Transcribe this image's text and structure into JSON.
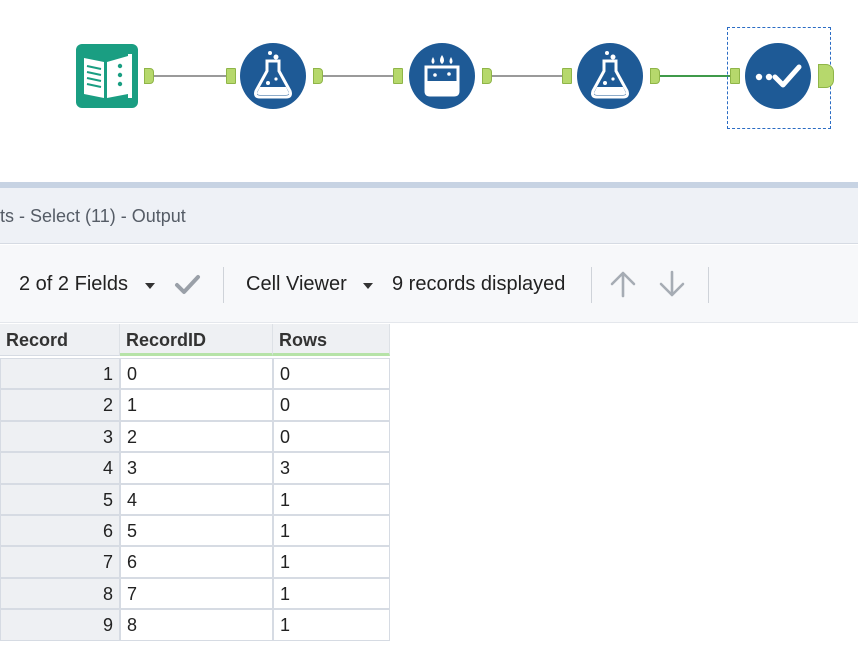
{
  "workflow": {
    "tools": [
      {
        "name": "input-data-tool",
        "icon": "book-icon",
        "color": "#1a9e82"
      },
      {
        "name": "formula-tool-1",
        "icon": "flask-icon",
        "color": "#1e5a96"
      },
      {
        "name": "multi-row-formula-tool",
        "icon": "multi-flask-icon",
        "color": "#1e5a96"
      },
      {
        "name": "formula-tool-2",
        "icon": "flask-icon",
        "color": "#1e5a96"
      },
      {
        "name": "select-tool",
        "icon": "checkmark-dots-icon",
        "color": "#1e5a96"
      }
    ]
  },
  "results": {
    "title": "ts - Select (11) - Output",
    "fields_selector": "2 of 2 Fields",
    "viewer_selector": "Cell Viewer",
    "records_status": "9 records displayed"
  },
  "grid": {
    "headers": [
      "Record",
      "RecordID",
      "Rows"
    ],
    "rows": [
      {
        "record": "1",
        "recordid": "0",
        "rows": "0"
      },
      {
        "record": "2",
        "recordid": "1",
        "rows": "0"
      },
      {
        "record": "3",
        "recordid": "2",
        "rows": "0"
      },
      {
        "record": "4",
        "recordid": "3",
        "rows": "3"
      },
      {
        "record": "5",
        "recordid": "4",
        "rows": "1"
      },
      {
        "record": "6",
        "recordid": "5",
        "rows": "1"
      },
      {
        "record": "7",
        "recordid": "6",
        "rows": "1"
      },
      {
        "record": "8",
        "recordid": "7",
        "rows": "1"
      },
      {
        "record": "9",
        "recordid": "8",
        "rows": "1"
      }
    ]
  }
}
